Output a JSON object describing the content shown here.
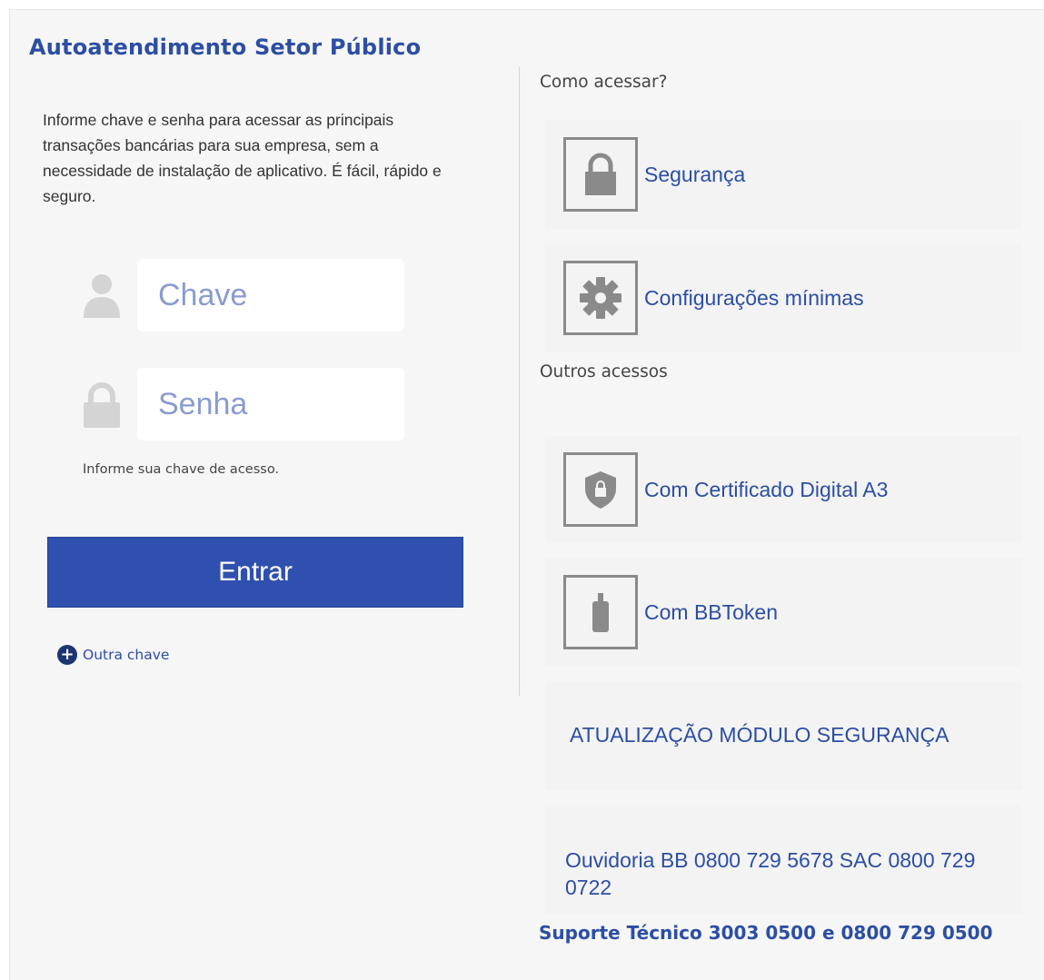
{
  "page": {
    "title": "Autoatendimento Setor Público",
    "intro": "Informe chave e senha para acessar as principais transações bancárias para sua empresa, sem a necessidade de instalação de aplicativo. É fácil, rápido e seguro."
  },
  "login": {
    "chave_placeholder": "Chave",
    "senha_placeholder": "Senha",
    "hint": "Informe sua chave de acesso.",
    "entrar_label": "Entrar",
    "outra_chave_label": "Outra chave"
  },
  "sidebar": {
    "como_acessar": "Como acessar?",
    "outros_acessos": "Outros acessos",
    "items": [
      {
        "label": "Segurança",
        "icon": "lock-icon"
      },
      {
        "label": "Configurações mínimas",
        "icon": "gear-icon"
      },
      {
        "label": "Com Certificado Digital A3",
        "icon": "shield-lock-icon"
      },
      {
        "label": "Com BBToken",
        "icon": "usb-token-icon"
      }
    ],
    "atualizacao": "ATUALIZAÇÃO MÓDULO SEGURANÇA",
    "ouvidoria": "Ouvidoria BB 0800 729 5678 SAC 0800 729 0722",
    "suporte": "Suporte Técnico 3003 0500 e 0800 729 0500"
  },
  "colors": {
    "brand_blue": "#2c4ea3",
    "button_blue": "#3050b0",
    "panel_bg": "#f6f6f6",
    "icon_gray": "#8a8a8a"
  }
}
